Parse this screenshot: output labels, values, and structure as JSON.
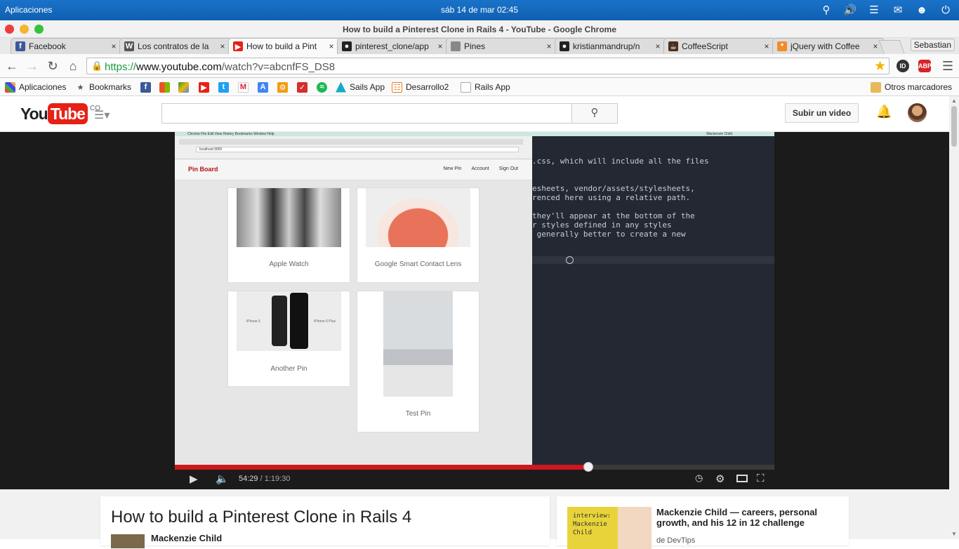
{
  "system": {
    "apps_label": "Aplicaciones",
    "clock": "sáb 14 de mar 02:45"
  },
  "window": {
    "title": "How to build a Pinterest Clone in Rails 4 - YouTube - Google Chrome"
  },
  "tabs": [
    {
      "label": "Facebook",
      "icon": "facebook-icon",
      "color": "#3b5998"
    },
    {
      "label": "Los contratos de la",
      "icon": "wikipedia-icon",
      "color": "#555555"
    },
    {
      "label": "How to build a Pint",
      "icon": "youtube-icon",
      "color": "#e62117",
      "active": true
    },
    {
      "label": "pinterest_clone/app",
      "icon": "github-icon",
      "color": "#222222"
    },
    {
      "label": "Pines",
      "icon": "page-icon",
      "color": "#888888"
    },
    {
      "label": "kristianmandrup/n",
      "icon": "github-icon",
      "color": "#222222"
    },
    {
      "label": "CoffeeScript",
      "icon": "coffee-icon",
      "color": "#4b2e1e"
    },
    {
      "label": "jQuery with Coffee",
      "icon": "asterisk-icon",
      "color": "#f28c28"
    }
  ],
  "profile_name": "Sebastian",
  "omnibox": {
    "https": "https://",
    "host": "www.youtube.com",
    "path": "/watch?v=abcnfFS_DS8"
  },
  "extensions": {
    "id_label": "ID",
    "abp_label": "ABP"
  },
  "bookmarks": {
    "apps": "Aplicaciones",
    "bookmarks": "Bookmarks",
    "sails": "Sails App",
    "desarrollo": "Desarrollo2",
    "rails": "Rails App",
    "others": "Otros marcadores"
  },
  "youtube": {
    "logo_you": "You",
    "logo_tube": "Tube",
    "country": "CO",
    "upload_label": "Subir un video"
  },
  "video": {
    "pinboard": {
      "brand": "Pin Board",
      "nav": [
        "New Pin",
        "Account",
        "Sign Out"
      ],
      "address": "localhost:3000",
      "pins": [
        "Apple Watch",
        "Google Smart Contact Lens",
        "Another Pin",
        "Test Pin"
      ],
      "iphone_left": "iPhone 6",
      "iphone_right": "iPhone 6 Plus"
    },
    "editor_lines": [
      ".css, which will include all the files",
      "",
      "",
      "esheets, vendor/assets/stylesheets,",
      "renced here using a relative path.",
      "",
      "they'll appear at the bottom of the",
      "r styles defined in any styles",
      " generally better to create a new"
    ],
    "mac_menu": "Chrome   File   Edit   View   History   Bookmarks   Window   Help",
    "mac_user": "Mackenzie Child"
  },
  "player": {
    "current": "54:29",
    "duration": "1:19:30",
    "progress": 0.6897,
    "separator": " / "
  },
  "info": {
    "title": "How to build a Pinterest Clone in Rails 4",
    "channel": "Mackenzie Child"
  },
  "suggested": {
    "title": "Mackenzie Child — careers, personal growth, and his 12 in 12 challenge",
    "by": "de DevTips",
    "thumb_text": "interview:\nMackenzie\nChild"
  }
}
